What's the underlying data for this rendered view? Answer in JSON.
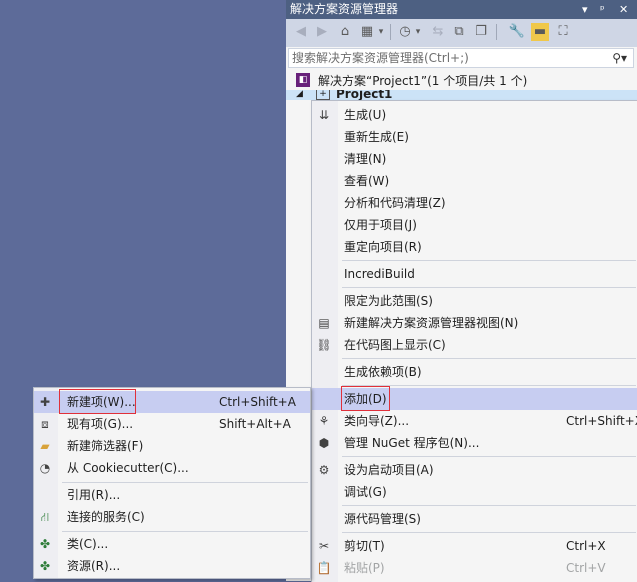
{
  "solution_explorer": {
    "title": "解决方案资源管理器",
    "title_controls": [
      "▾",
      "ᵖ",
      "✕"
    ],
    "search_placeholder": "搜索解决方案资源管理器(Ctrl+;)",
    "solution_label": "解决方案“Project1”(1 个项目/共 1 个)",
    "project_label": "Project1"
  },
  "context_menu": {
    "items": [
      {
        "label": "生成(U)",
        "icon": "build-icon"
      },
      {
        "label": "重新生成(E)"
      },
      {
        "label": "清理(N)"
      },
      {
        "label": "查看(W)"
      },
      {
        "label": "分析和代码清理(Z)"
      },
      {
        "label": "仅用于项目(J)"
      },
      {
        "label": "重定向项目(R)"
      },
      {
        "label": "IncrediBuild"
      },
      {
        "label": "限定为此范围(S)"
      },
      {
        "label": "新建解决方案资源管理器视图(N)",
        "icon": "new-view-icon"
      },
      {
        "label": "在代码图上显示(C)",
        "icon": "code-map-icon"
      },
      {
        "label": "生成依赖项(B)"
      },
      {
        "label": "添加(D)"
      },
      {
        "label": "类向导(Z)...",
        "shortcut": "Ctrl+Shift+X",
        "icon": "class-wizard-icon"
      },
      {
        "label": "管理 NuGet 程序包(N)...",
        "icon": "nuget-icon"
      },
      {
        "label": "设为启动项目(A)",
        "icon": "gear-icon"
      },
      {
        "label": "调试(G)"
      },
      {
        "label": "源代码管理(S)"
      },
      {
        "label": "剪切(T)",
        "shortcut": "Ctrl+X",
        "icon": "cut-icon"
      },
      {
        "label": "粘贴(P)",
        "shortcut": "Ctrl+V",
        "icon": "paste-icon"
      }
    ]
  },
  "add_submenu": {
    "items": [
      {
        "label": "新建项(W)...",
        "shortcut": "Ctrl+Shift+A",
        "icon": "new-item-icon"
      },
      {
        "label": "现有项(G)...",
        "shortcut": "Shift+Alt+A",
        "icon": "existing-item-icon"
      },
      {
        "label": "新建筛选器(F)",
        "icon": "new-filter-icon"
      },
      {
        "label": "从 Cookiecutter(C)...",
        "icon": "cookiecutter-icon"
      },
      {
        "label": "引用(R)..."
      },
      {
        "label": "连接的服务(C)",
        "icon": "connected-service-icon"
      },
      {
        "label": "类(C)...",
        "icon": "add-class-icon"
      },
      {
        "label": "资源(R)...",
        "icon": "resource-icon"
      }
    ]
  },
  "colors": {
    "background": "#5d6b99",
    "title_bar": "#4d6082",
    "highlight": "#c7cdf1",
    "red_outline": "#e0303a"
  }
}
